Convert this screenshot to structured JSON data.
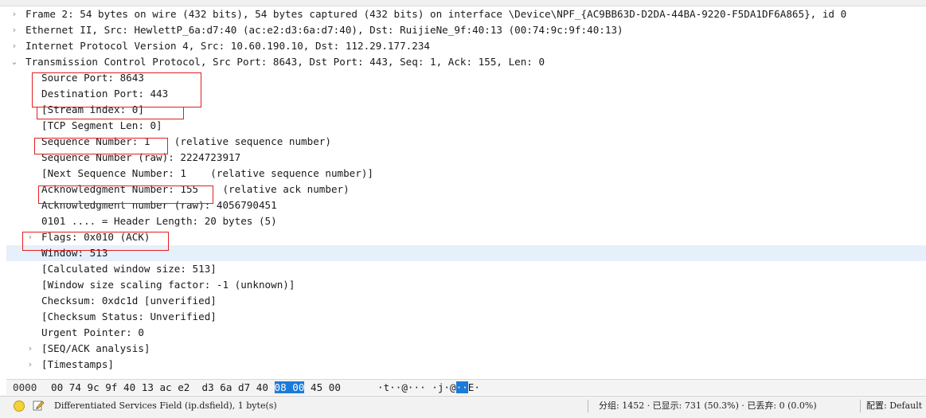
{
  "packet_tree": [
    {
      "name": "frame-row",
      "expander": ">",
      "level": 0,
      "text": "Frame 2: 54 bytes on wire (432 bits), 54 bytes captured (432 bits) on interface \\Device\\NPF_{AC9BB63D-D2DA-44BA-9220-F5DA1DF6A865}, id 0"
    },
    {
      "name": "ethernet-row",
      "expander": ">",
      "level": 0,
      "text": "Ethernet II, Src: HewlettP_6a:d7:40 (ac:e2:d3:6a:d7:40), Dst: RuijieNe_9f:40:13 (00:74:9c:9f:40:13)"
    },
    {
      "name": "ip-row",
      "expander": ">",
      "level": 0,
      "text": "Internet Protocol Version 4, Src: 10.60.190.10, Dst: 112.29.177.234"
    },
    {
      "name": "tcp-row",
      "expander": "v",
      "level": 0,
      "text": "Transmission Control Protocol, Src Port: 8643, Dst Port: 443, Seq: 1, Ack: 155, Len: 0"
    },
    {
      "name": "source-port-row",
      "expander": "",
      "level": 1,
      "text": "Source Port: 8643"
    },
    {
      "name": "destination-port-row",
      "expander": "",
      "level": 1,
      "text": "Destination Port: 443"
    },
    {
      "name": "stream-index-row",
      "expander": "",
      "level": 1,
      "text": "[Stream index: 0]"
    },
    {
      "name": "tcp-segment-len-row",
      "expander": "",
      "level": 1,
      "text": "[TCP Segment Len: 0]"
    },
    {
      "name": "sequence-number-row",
      "expander": "",
      "level": 1,
      "text": "Sequence Number: 1    (relative sequence number)"
    },
    {
      "name": "sequence-number-raw-row",
      "expander": "",
      "level": 1,
      "text": "Sequence Number (raw): 2224723917"
    },
    {
      "name": "next-sequence-number-row",
      "expander": "",
      "level": 1,
      "text": "[Next Sequence Number: 1    (relative sequence number)]"
    },
    {
      "name": "acknowledgment-number-row",
      "expander": "",
      "level": 1,
      "text": "Acknowledgment Number: 155    (relative ack number)"
    },
    {
      "name": "acknowledgment-number-raw-row",
      "expander": "",
      "level": 1,
      "text": "Acknowledgment number (raw): 4056790451"
    },
    {
      "name": "header-length-row",
      "expander": "",
      "level": 1,
      "text": "0101 .... = Header Length: 20 bytes (5)"
    },
    {
      "name": "flags-row",
      "expander": ">",
      "level": 1,
      "text": "Flags: 0x010 (ACK)"
    },
    {
      "name": "window-row",
      "expander": "",
      "level": 1,
      "text": "Window: 513",
      "selected": true
    },
    {
      "name": "calculated-window-size-row",
      "expander": "",
      "level": 1,
      "text": "[Calculated window size: 513]"
    },
    {
      "name": "window-scaling-factor-row",
      "expander": "",
      "level": 1,
      "text": "[Window size scaling factor: -1 (unknown)]"
    },
    {
      "name": "checksum-row",
      "expander": "",
      "level": 1,
      "text": "Checksum: 0xdc1d [unverified]"
    },
    {
      "name": "checksum-status-row",
      "expander": "",
      "level": 1,
      "text": "[Checksum Status: Unverified]"
    },
    {
      "name": "urgent-pointer-row",
      "expander": "",
      "level": 1,
      "text": "Urgent Pointer: 0"
    },
    {
      "name": "seq-ack-analysis-row",
      "expander": ">",
      "level": 1,
      "text": "[SEQ/ACK analysis]"
    },
    {
      "name": "timestamps-row",
      "expander": ">",
      "level": 1,
      "text": "[Timestamps]"
    }
  ],
  "hex_view": {
    "offset": "0000",
    "bytes_before": "00 74 9c 9f 40 13 ac e2  d3 6a d7 40 ",
    "bytes_selected": "08 00",
    "bytes_after": " 45 00",
    "ascii_before": "·t··@··· ·j·@",
    "ascii_selected": "··",
    "ascii_after": "E·"
  },
  "status_bar": {
    "message": "Differentiated Services Field (ip.dsfield), 1 byte(s)",
    "packets": "分组: 1452 · 已显示: 731 (50.3%) · 已丢弃: 0 (0.0%)",
    "profile": "配置: Default"
  },
  "colors": {
    "highlight_box": "#e02020",
    "selected_row": "#e6f0fb",
    "hex_selected": "#1c7ad8",
    "status_indicator": "#f4d23a"
  }
}
